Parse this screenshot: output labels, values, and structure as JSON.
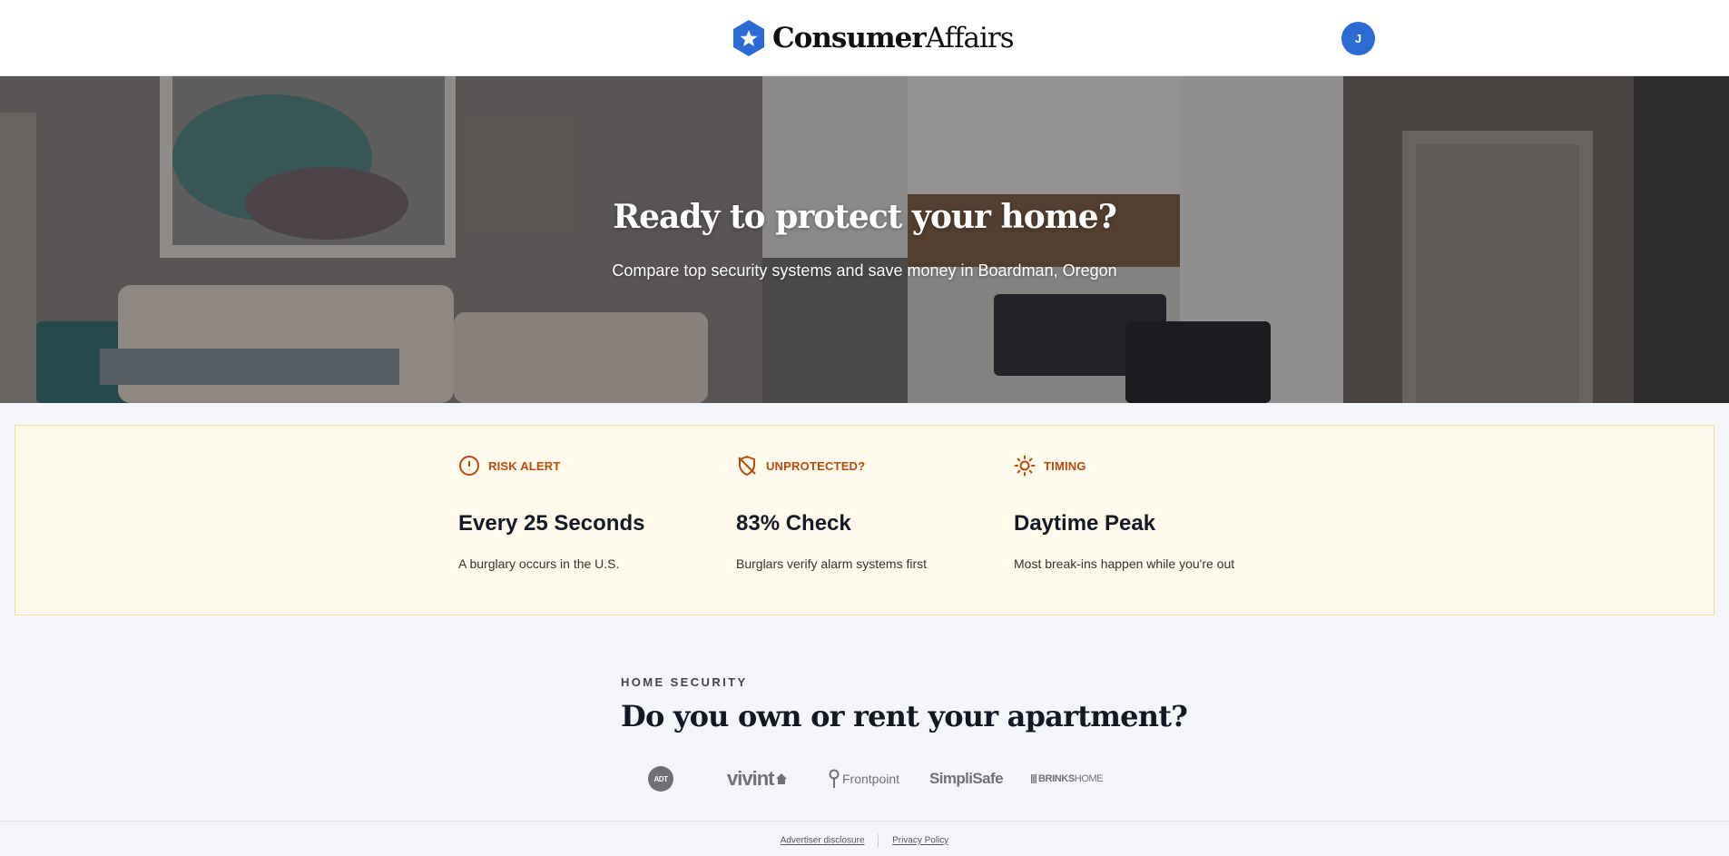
{
  "header": {
    "logo": {
      "bold": "Consumer",
      "light": "Affairs",
      "icon": "star-badge-icon"
    },
    "avatar_initial": "J"
  },
  "hero": {
    "title": "Ready to protect your home?",
    "subtitle": "Compare top security systems and save money in Boardman, Oregon"
  },
  "alerts": [
    {
      "icon": "alert-circle-icon",
      "label": "RISK ALERT",
      "value": "Every 25 Seconds",
      "desc": "A burglary occurs in the U.S."
    },
    {
      "icon": "shield-off-icon",
      "label": "UNPROTECTED?",
      "value": "83% Check",
      "desc": "Burglars verify alarm systems first"
    },
    {
      "icon": "sun-icon",
      "label": "TIMING",
      "value": "Daytime Peak",
      "desc": "Most break-ins happen while you're out"
    }
  ],
  "question": {
    "eyebrow": "HOME SECURITY",
    "title": "Do you own or rent your apartment?"
  },
  "brands": {
    "adt": "ADT",
    "vivint": "vivint",
    "frontpoint": "Frontpoint",
    "simplisafe": "SimpliSafe",
    "brinks_bold": "BRINKS",
    "brinks_light": "HOME"
  },
  "footer": {
    "advertiser": "Advertiser disclosure",
    "privacy": "Privacy Policy"
  },
  "colors": {
    "brand_blue": "#2c6ad4",
    "alert_orange": "#b84a0c",
    "alert_band_bg": "#fffaeb",
    "alert_band_border": "#f5dc9a"
  }
}
